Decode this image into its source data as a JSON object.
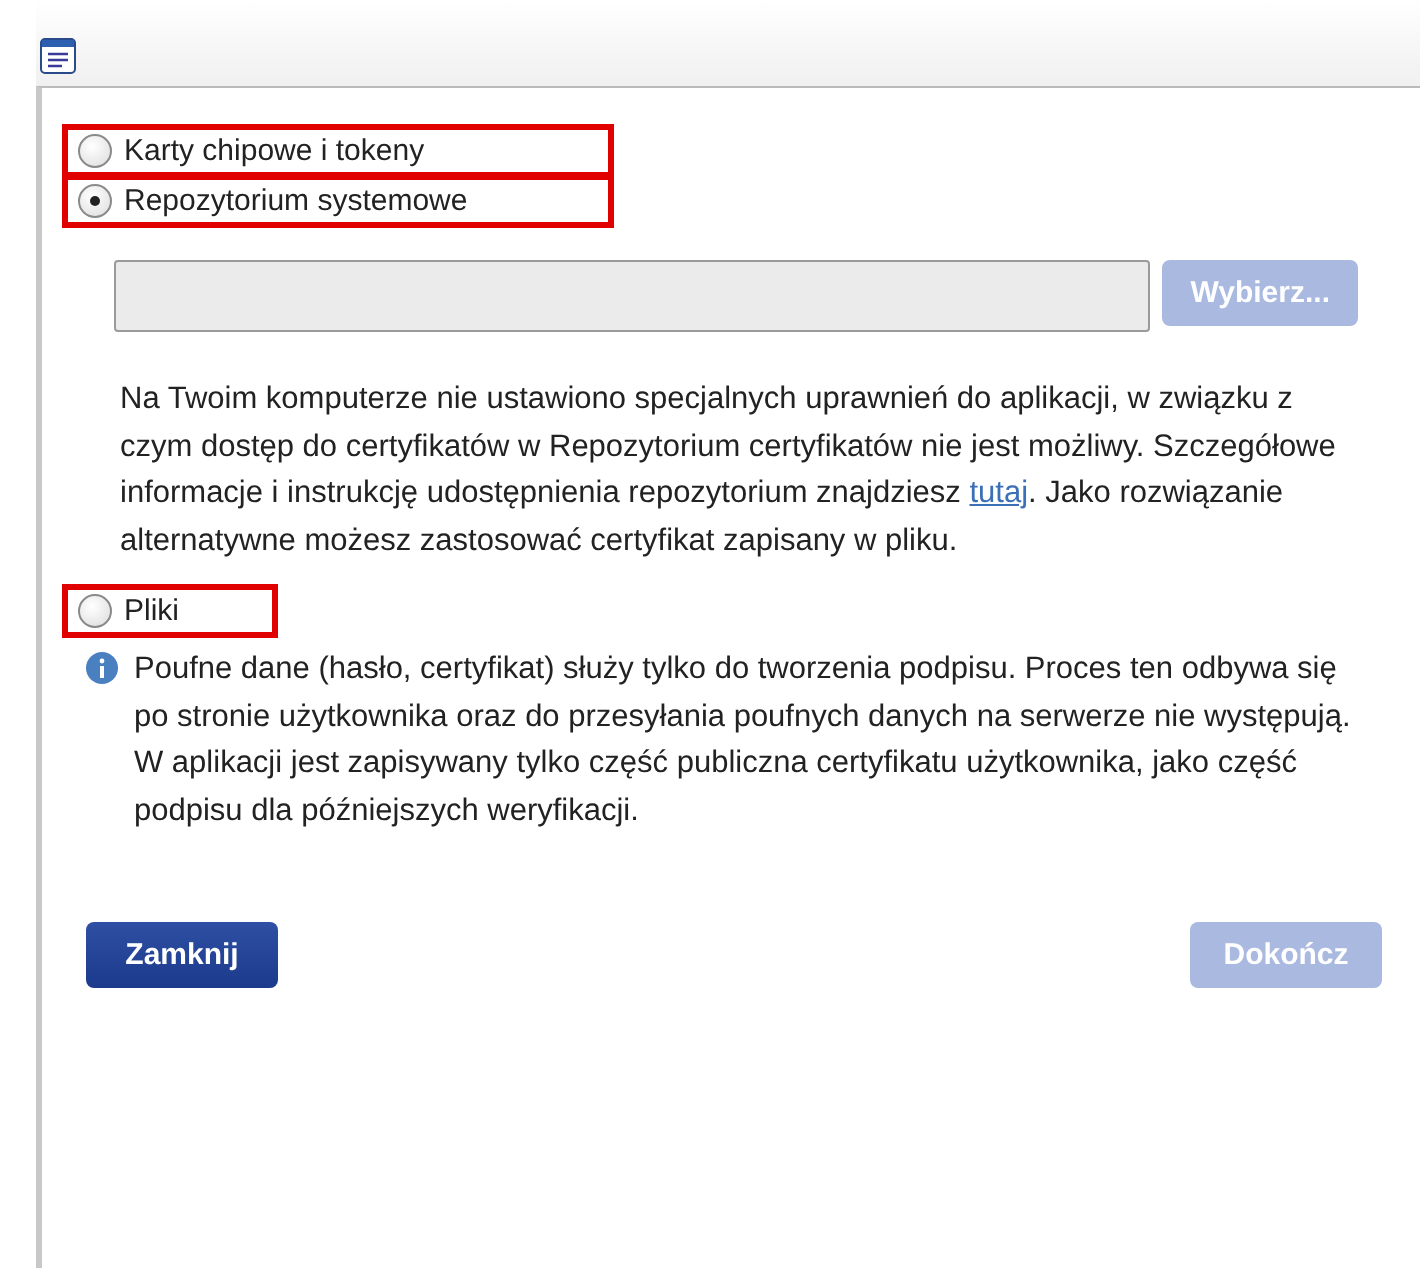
{
  "options": [
    {
      "label": "Karty chipowe i tokeny",
      "selected": false,
      "highlighted": true
    },
    {
      "label": "Repozytorium systemowe",
      "selected": true,
      "highlighted": true
    }
  ],
  "file_field": {
    "button": {
      "label": "Wybierz...",
      "disabled": true
    }
  },
  "notice": {
    "before": "Na Twoim komputerze nie ustawiono specjalnych uprawnień do aplikacji, w związku z czym dostęp do certyfikatów w Repozytorium certyfikatów nie jest możliwy. Szczegółowe informacje i instrukcję udostępnienia repozytorium znajdziesz ",
    "link": "tutaj",
    "after": ". Jako rozwiązanie alternatywne możesz zastosować certyfikat zapisany w pliku."
  },
  "file_option": {
    "label": "Pliki",
    "selected": false,
    "highlighted": true
  },
  "info": "Poufne dane (hasło, certyfikat) służy tylko do tworzenia podpisu. Proces ten odbywa się po stronie użytkownika oraz do przesyłania poufnych danych na serwerze nie występują. W aplikacji jest zapisywany tylko część publiczna certyfikatu użytkownika, jako część podpisu dla późniejszych weryfikacji.",
  "buttons": [
    {
      "label": "Zamknij",
      "disabled": false
    },
    {
      "label": "Dokończ",
      "disabled": true
    }
  ]
}
